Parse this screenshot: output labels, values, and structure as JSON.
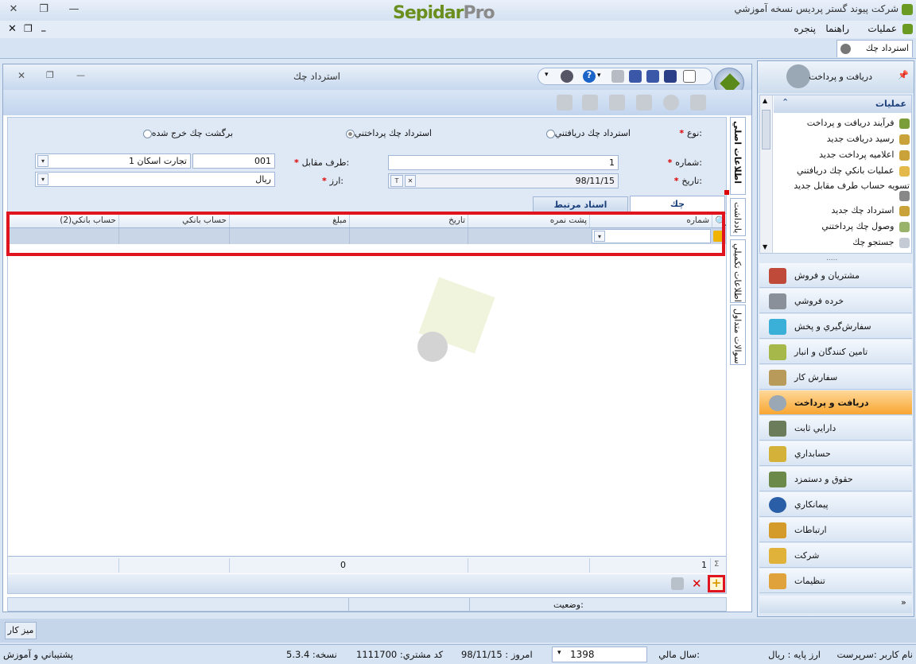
{
  "app": {
    "logo_part1": "Sepidar",
    "logo_part2": "Pro",
    "title": "شرکت پیوند گستر پردیس نسخه آموزشي"
  },
  "menu": [
    "عمليات",
    "راهنما",
    "پنجره"
  ],
  "doc_tab": {
    "label": "استرداد چك"
  },
  "window": {
    "title": "استرداد چك",
    "type_label": "نوع:",
    "type_options": [
      "استرداد چك دريافتني",
      "استرداد چك پرداختني",
      "برگشت چك خرج شده"
    ],
    "type_selected_index": 1,
    "number_label": "شماره:",
    "number_value": "1",
    "date_label": "تاريخ:",
    "date_value": "98/11/15",
    "party_label": "طرف مقابل:",
    "party_code": "001",
    "party_name": "تجارت اسكان 1",
    "currency_label": "ارز:",
    "currency_value": "ريال"
  },
  "tabs": [
    "چك",
    "اسناد مرتبط"
  ],
  "vertical_tabs": [
    "اطلاعات اصلي",
    "يادداشت",
    "اطلاعات تكميلي",
    "سوالات متداول"
  ],
  "grid": {
    "columns": [
      "شماره",
      "پشت نمره",
      "تاريخ",
      "مبلغ",
      "حساب بانكي",
      "حساب بانكي(2)"
    ],
    "total_count": "1",
    "total_amount": "0"
  },
  "status_label": "وضعيت:",
  "nav": {
    "header": "دريافت و پرداخت",
    "ops_title": "عمليات",
    "ops": [
      "فرآيند دريافت و پرداخت",
      "رسيد دريافت جديد",
      "اعلاميه پرداخت جديد",
      "عمليات بانكي چك دريافتني",
      "تسويه حساب طرف مقابل جديد",
      "استرداد چك جديد",
      "وصول چك پرداختني",
      "جستجو چك"
    ],
    "modules": [
      "مشتريان و فروش",
      "خرده فروشي",
      "سفارش‌گيري و پخش",
      "تامين كنندگان و انبار",
      "سفارش كار",
      "دريافت و پرداخت",
      "دارايي ثابت",
      "حسابداري",
      "حقوق و دستمزد",
      "پيمانكاري",
      "ارتباطات",
      "شركت",
      "تنظيمات"
    ],
    "active_module_index": 5
  },
  "taskbar": {
    "desk_label": "ميز كار"
  },
  "statusbar": {
    "user_label": "نام كاربر :سرپرست",
    "base_currency": "ارز پايه :   ريال",
    "fiscal_year_label": "سال مالي:",
    "fiscal_year": "1398",
    "today": "امروز :   98/11/15",
    "customer_code": "كد مشتري:   1111700",
    "version": "نسخه:   5.3.4",
    "support": "پشتيباني و آموزش"
  }
}
